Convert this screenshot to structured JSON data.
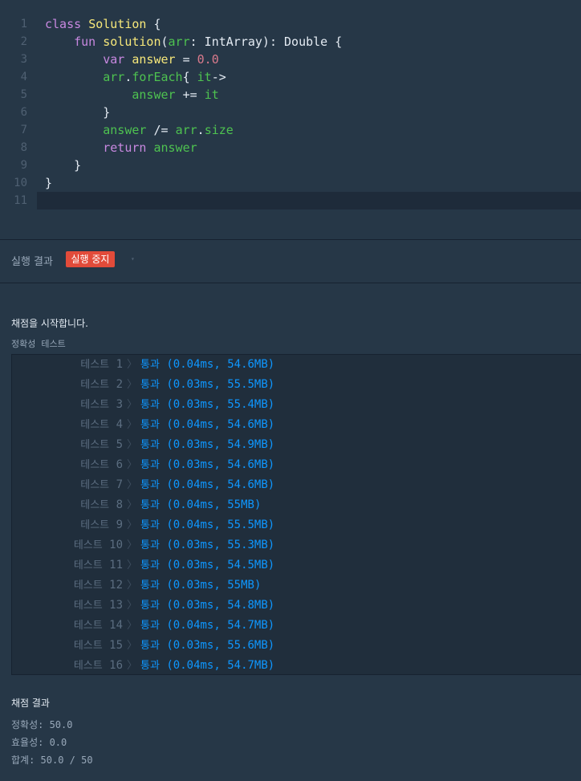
{
  "editor": {
    "lines": [
      {
        "n": "1",
        "parts": [
          [
            "kw",
            "class"
          ],
          [
            "pl",
            " "
          ],
          [
            "fn",
            "Solution"
          ],
          [
            "pl",
            " {"
          ]
        ]
      },
      {
        "n": "2",
        "parts": [
          [
            "pl",
            "    "
          ],
          [
            "kw",
            "fun"
          ],
          [
            "pl",
            " "
          ],
          [
            "fn",
            "solution"
          ],
          [
            "pl",
            "("
          ],
          [
            "id",
            "arr"
          ],
          [
            "pl",
            ": IntArray): Double {"
          ]
        ]
      },
      {
        "n": "3",
        "parts": [
          [
            "pl",
            "        "
          ],
          [
            "kw",
            "var"
          ],
          [
            "pl",
            " "
          ],
          [
            "fn",
            "answer"
          ],
          [
            "pl",
            " = "
          ],
          [
            "num",
            "0.0"
          ]
        ]
      },
      {
        "n": "4",
        "parts": [
          [
            "pl",
            "        "
          ],
          [
            "id",
            "arr"
          ],
          [
            "pl",
            "."
          ],
          [
            "id",
            "forEach"
          ],
          [
            "pl",
            "{ "
          ],
          [
            "id",
            "it"
          ],
          [
            "pl",
            "->"
          ]
        ]
      },
      {
        "n": "5",
        "parts": [
          [
            "pl",
            "            "
          ],
          [
            "id",
            "answer"
          ],
          [
            "pl",
            " += "
          ],
          [
            "id",
            "it"
          ]
        ]
      },
      {
        "n": "6",
        "parts": [
          [
            "pl",
            "        }"
          ]
        ]
      },
      {
        "n": "7",
        "parts": [
          [
            "pl",
            "        "
          ],
          [
            "id",
            "answer"
          ],
          [
            "pl",
            " /= "
          ],
          [
            "id",
            "arr"
          ],
          [
            "pl",
            "."
          ],
          [
            "id",
            "size"
          ]
        ]
      },
      {
        "n": "8",
        "parts": [
          [
            "pl",
            "        "
          ],
          [
            "kw",
            "return"
          ],
          [
            "pl",
            " "
          ],
          [
            "id",
            "answer"
          ]
        ]
      },
      {
        "n": "9",
        "parts": [
          [
            "pl",
            "    }"
          ]
        ]
      },
      {
        "n": "10",
        "parts": [
          [
            "pl",
            "}"
          ]
        ]
      },
      {
        "n": "11",
        "parts": []
      }
    ]
  },
  "run": {
    "title": "실행 결과",
    "stop_label": "실행 중지",
    "caret_icon": "caret-down-icon"
  },
  "output": {
    "start_text": "채점을 시작합니다.",
    "section_label": "정확성  테스트",
    "test_word": "테스트",
    "pass_word": "통과",
    "tests": [
      {
        "num": "1",
        "time": "0.04ms",
        "mem": "54.6MB"
      },
      {
        "num": "2",
        "time": "0.03ms",
        "mem": "55.5MB"
      },
      {
        "num": "3",
        "time": "0.03ms",
        "mem": "55.4MB"
      },
      {
        "num": "4",
        "time": "0.04ms",
        "mem": "54.6MB"
      },
      {
        "num": "5",
        "time": "0.03ms",
        "mem": "54.9MB"
      },
      {
        "num": "6",
        "time": "0.03ms",
        "mem": "54.6MB"
      },
      {
        "num": "7",
        "time": "0.04ms",
        "mem": "54.6MB"
      },
      {
        "num": "8",
        "time": "0.04ms",
        "mem": "55MB"
      },
      {
        "num": "9",
        "time": "0.04ms",
        "mem": "55.5MB"
      },
      {
        "num": "10",
        "time": "0.03ms",
        "mem": "55.3MB"
      },
      {
        "num": "11",
        "time": "0.03ms",
        "mem": "54.5MB"
      },
      {
        "num": "12",
        "time": "0.03ms",
        "mem": "55MB"
      },
      {
        "num": "13",
        "time": "0.03ms",
        "mem": "54.8MB"
      },
      {
        "num": "14",
        "time": "0.04ms",
        "mem": "54.7MB"
      },
      {
        "num": "15",
        "time": "0.03ms",
        "mem": "55.6MB"
      },
      {
        "num": "16",
        "time": "0.04ms",
        "mem": "54.7MB"
      }
    ],
    "grade_title": "채점 결과",
    "grade": {
      "accuracy_label": "정확성",
      "accuracy_value": "50.0",
      "efficiency_label": "효율성",
      "efficiency_value": "0.0",
      "total_label": "합계",
      "total_value": "50.0 / 50"
    }
  },
  "colors": {
    "background": "#263747",
    "stop_button": "#e24b3a",
    "pass_text": "#0e97ff"
  }
}
